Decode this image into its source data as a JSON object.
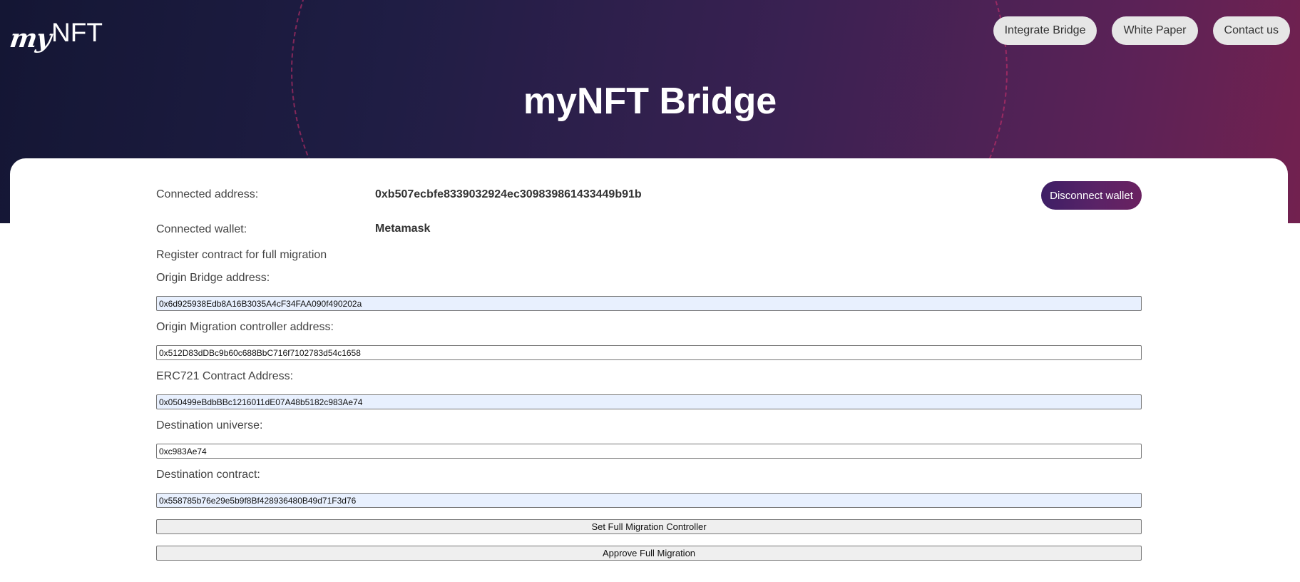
{
  "header": {
    "logo": {
      "script": "my",
      "text": "NFT"
    },
    "nav": [
      "Integrate Bridge",
      "White Paper",
      "Contact us"
    ],
    "title": "myNFT Bridge"
  },
  "account": {
    "address_label": "Connected address:",
    "address_value": "0xb507ecbfe8339032924ec309839861433449b91b",
    "wallet_label": "Connected wallet:",
    "wallet_value": "Metamask",
    "disconnect_label": "Disconnect wallet"
  },
  "form": {
    "section_title": "Register contract for full migration",
    "fields": [
      {
        "label": "Origin Bridge address:",
        "value": "0x6d925938Edb8A16B3035A4cF34FAA090f490202a",
        "autofill": true
      },
      {
        "label": "Origin Migration controller address:",
        "value": "0x512D83dDBc9b60c688BbC716f7102783d54c1658",
        "autofill": false
      },
      {
        "label": "ERC721 Contract Address:",
        "value": "0x050499eBdbBBc1216011dE07A48b5182c983Ae74",
        "autofill": true
      },
      {
        "label": "Destination universe:",
        "value": "0xc983Ae74",
        "autofill": false
      },
      {
        "label": "Destination contract:",
        "value": "0x558785b76e29e5b9f8Bf428936480B49d71F3d76",
        "autofill": true
      }
    ],
    "buttons": [
      "Set Full Migration Controller",
      "Approve Full Migration"
    ]
  },
  "colors": {
    "hero_start": "#141634",
    "hero_end": "#72214f",
    "accent": "#4a2166",
    "autofill_bg": "#e8f0fe"
  }
}
